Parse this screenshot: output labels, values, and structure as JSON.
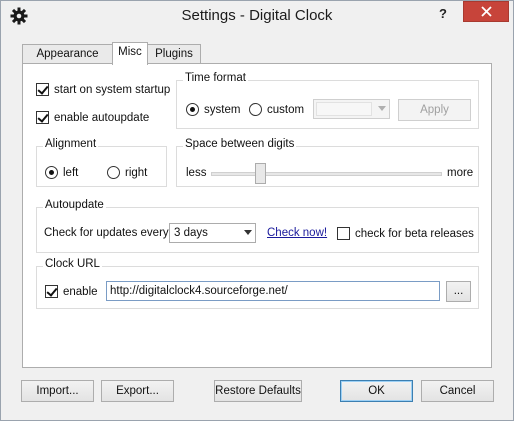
{
  "window": {
    "title": "Settings - Digital Clock",
    "help_label": "?"
  },
  "tabs": [
    {
      "label": "Appearance"
    },
    {
      "label": "Misc"
    },
    {
      "label": "Plugins"
    }
  ],
  "misc": {
    "start_on_startup": {
      "label": "start on system startup",
      "checked": true
    },
    "enable_autoupdate": {
      "label": "enable autoupdate",
      "checked": true
    },
    "time_format": {
      "title": "Time format",
      "system_label": "system",
      "custom_label": "custom",
      "selected": "system",
      "custom_value": "",
      "apply_label": "Apply"
    },
    "alignment": {
      "title": "Alignment",
      "left_label": "left",
      "right_label": "right",
      "selected": "left"
    },
    "space_between_digits": {
      "title": "Space between digits",
      "less_label": "less",
      "more_label": "more",
      "level": 0.2
    },
    "autoupdate": {
      "title": "Autoupdate",
      "check_label": "Check for updates every",
      "interval": "3 days",
      "check_now_label": "Check now!",
      "beta_label": "check for beta releases",
      "beta_checked": false
    },
    "clock_url": {
      "title": "Clock URL",
      "enable_label": "enable",
      "enable_checked": true,
      "url": "http://digitalclock4.sourceforge.net/",
      "browse_label": "..."
    }
  },
  "footer": {
    "import_label": "Import...",
    "export_label": "Export...",
    "restore_label": "Restore Defaults",
    "ok_label": "OK",
    "cancel_label": "Cancel"
  }
}
